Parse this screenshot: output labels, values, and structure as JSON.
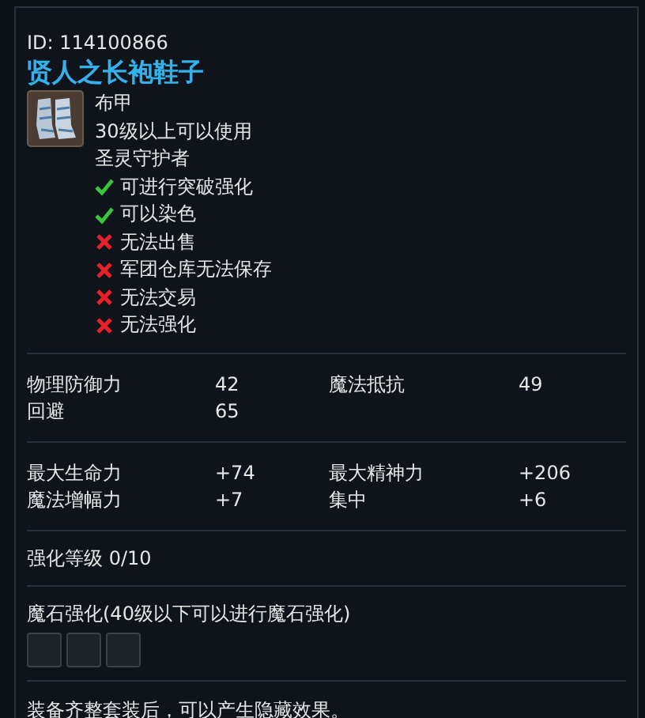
{
  "id_line": "ID: 114100866",
  "title": "贤人之长袍鞋子",
  "info": [
    "布甲",
    "30级以上可以使用",
    "圣灵守护者"
  ],
  "properties": [
    {
      "kind": "check",
      "text": "可进行突破强化"
    },
    {
      "kind": "check",
      "text": "可以染色"
    },
    {
      "kind": "cross",
      "text": "无法出售"
    },
    {
      "kind": "cross",
      "text": "军团仓库无法保存"
    },
    {
      "kind": "cross",
      "text": "无法交易"
    },
    {
      "kind": "cross",
      "text": "无法强化"
    }
  ],
  "stat_groups": [
    [
      {
        "label": "物理防御力",
        "value": "42"
      },
      {
        "label": "魔法抵抗",
        "value": "49"
      },
      {
        "label": "回避",
        "value": "65"
      }
    ],
    [
      {
        "label": "最大生命力",
        "value": "+74"
      },
      {
        "label": "最大精神力",
        "value": "+206"
      },
      {
        "label": "魔法增幅力",
        "value": "+7"
      },
      {
        "label": "集中",
        "value": "+6"
      }
    ]
  ],
  "enchant_level": "强化等级 0/10",
  "manastone": {
    "title": "魔石强化(40级以下可以进行魔石强化)",
    "sockets": [
      {
        "kind": "empty"
      },
      {
        "kind": "empty"
      },
      {
        "kind": "empty"
      }
    ]
  },
  "set_note": "装备齐整套装后，可以产生隐藏效果。"
}
